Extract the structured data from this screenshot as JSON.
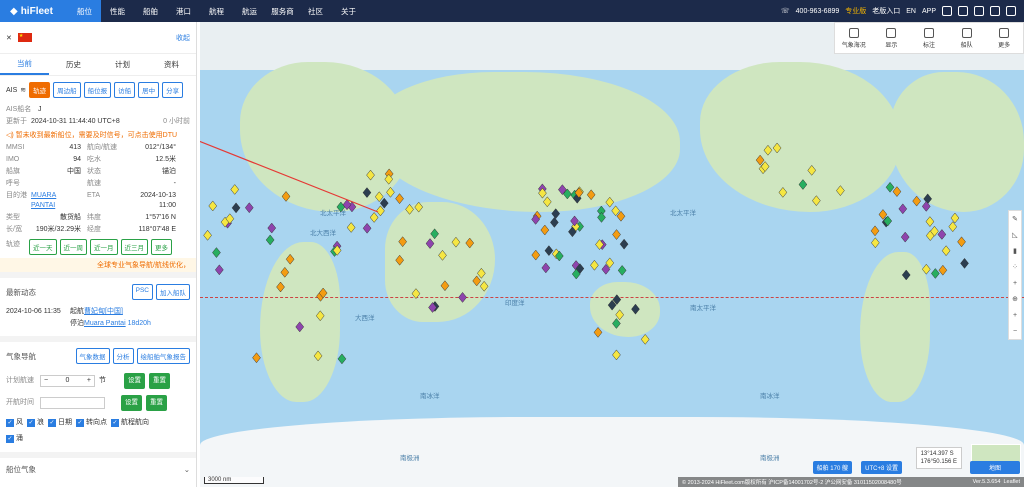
{
  "topbar": {
    "logo": "hiFleet",
    "nav": [
      "船位",
      "性能",
      "船舶",
      "港口",
      "航程",
      "航运",
      "服务商",
      "社区",
      "关于"
    ],
    "active_nav": "船位",
    "phone": "400-963-6899",
    "pro": "专业版",
    "old": "老版入口",
    "lang": "EN",
    "app": "APP"
  },
  "panel": {
    "collapse": "收起",
    "tabs": [
      "当前",
      "历史",
      "计划",
      "资料"
    ],
    "ais_label": "AIS",
    "actions": [
      "轨迹",
      "周边船",
      "船位报",
      "访船",
      "居中",
      "分享"
    ],
    "ais_name_label": "AIS船名",
    "ais_name_value": "J",
    "update_label": "更新于",
    "update_value": "2024-10-31 11:44:40 UTC+8",
    "update_ago": "0 小时前",
    "warning": "暂未收到最新船位，需要及时信号，可点击使用DTU",
    "fields": [
      {
        "k": "MMSI",
        "v": "413",
        "k2": "航向/航速",
        "v2": "012°/134°"
      },
      {
        "k": "IMO",
        "v": "94",
        "k2": "吃水",
        "v2": "12.5米"
      },
      {
        "k": "船旗",
        "v": "中国",
        "k2": "状态",
        "v2": "锚泊"
      },
      {
        "k": "呼号",
        "v": "",
        "k2": "航速",
        "v2": "-"
      }
    ],
    "dest_label": "目的港",
    "dest_value": "MUARA PANTAI",
    "eta_label": "ETA",
    "eta_value": "2024-10-13 11:00",
    "type_label": "类型",
    "type_value": "散货船",
    "lat_label": "纬度",
    "lat_value": "1°57'16 N",
    "size_label": "长/宽",
    "size_value": "190米/32.29米",
    "lon_label": "经度",
    "lon_value": "118°07'48 E",
    "track_label": "轨迹",
    "tracks": [
      "近一天",
      "近一周",
      "近一月",
      "近三月",
      "更多"
    ],
    "weather_promo": "全球专业气象导航/航线优化，",
    "news_title": "最新动态",
    "psc": "PSC",
    "join_fleet": "加入船队",
    "event_time": "2024-10-06 11:35",
    "event_type": "起航",
    "event_port": "曹妃甸[中国]",
    "event_stop": "停泊",
    "event_stop_port": "Muara Pantai",
    "event_dur": "18d20h",
    "wx_title": "气象导航",
    "wx_buttons": [
      "气象数据",
      "分析",
      "绘船舶气象报告"
    ],
    "plan_speed_label": "计划航速",
    "plan_speed_value": "0",
    "knot": "节",
    "set": "设置",
    "reset": "重置",
    "start_time_label": "开航时间",
    "checks": [
      "风",
      "浪",
      "日期",
      "转向点",
      "航程航向",
      "涌"
    ],
    "bottom_section": "船位气象"
  },
  "map": {
    "toolbox": [
      "气象海况",
      "显示",
      "标注",
      "船队",
      "更多"
    ],
    "scale": "3000 nm",
    "ocean_labels": [
      "北太平洋",
      "北大西洋",
      "印度洋",
      "南太平洋",
      "大西洋",
      "北太平洋",
      "南冰洋",
      "南冰洋",
      "南极洲",
      "南极洲"
    ],
    "coord_lat": "13°14.397 S",
    "coord_lon": "176°50.156 E",
    "ship_count": "船舶 170 艘",
    "utc_btn": "UTC+8 设置",
    "map_btn": "地图",
    "footer": "© 2013-2024 HiFleet.com版权所有 沪ICP备14001702号-2 沪公网安备 31011502008480号",
    "version": "Ver.5.3.654",
    "leaflet": "Leaflet"
  }
}
